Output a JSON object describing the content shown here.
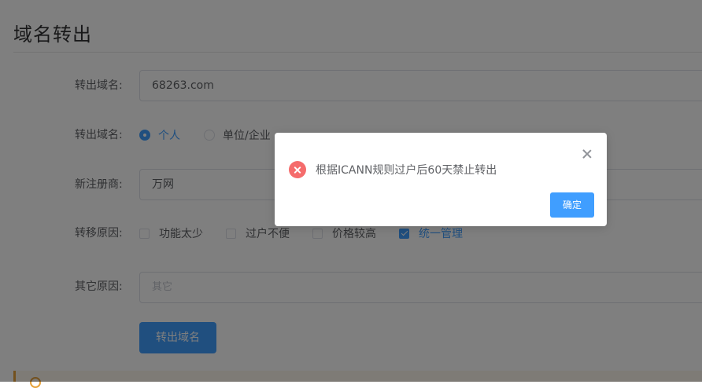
{
  "page": {
    "title": "域名转出"
  },
  "form": {
    "domain_label": "转出域名:",
    "domain_value": "68263.com",
    "owner_label": "转出域名:",
    "owner_options": [
      {
        "label": "个人",
        "checked": true
      },
      {
        "label": "单位/企业",
        "checked": false
      }
    ],
    "registrar_label": "新注册商:",
    "registrar_value": "万网",
    "reason_label": "转移原因:",
    "reason_options": [
      {
        "label": "功能太少",
        "checked": false
      },
      {
        "label": "过户不便",
        "checked": false
      },
      {
        "label": "价格较高",
        "checked": false
      },
      {
        "label": "统一管理",
        "checked": true
      }
    ],
    "other_reason_label": "其它原因:",
    "other_reason_placeholder": "其它",
    "submit_label": "转出域名"
  },
  "dialog": {
    "message": "根据ICANN规则过户后60天禁止转出",
    "confirm_label": "确定"
  },
  "colors": {
    "primary": "#409eff",
    "error": "#f56c6c",
    "warning": "#e6a23c"
  }
}
